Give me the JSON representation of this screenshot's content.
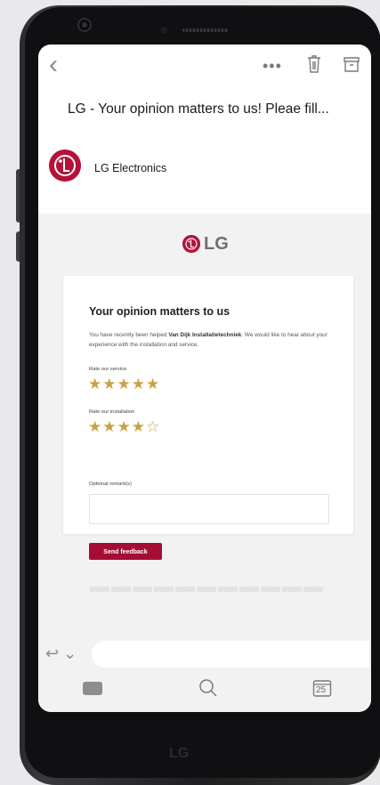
{
  "email": {
    "subject": "LG - Your opinion matters to us! Pleae fill...",
    "sender": "LG Electronics"
  },
  "brand": {
    "logo_text": "LG",
    "accent_color": "#b4123a"
  },
  "card": {
    "title": "Your opinion matters to us",
    "desc_prefix": "You have recently been helped ",
    "desc_company": "Van Dijk Installatietechniek",
    "desc_suffix": ". We would like to hear about your experience with the installation and service.",
    "service_label": "Rate our service",
    "service_rating": 5,
    "installation_label": "Rate our installation",
    "installation_rating": 4,
    "rating_max": 5,
    "remark_label": "Optional remark(s)",
    "send_label": "Send feedback"
  },
  "tabbar": {
    "calendar_day": "25"
  },
  "icons": [
    "back-icon",
    "more-icon",
    "trash-icon",
    "archive-icon",
    "reply-icon",
    "mail-icon",
    "search-icon",
    "calendar-icon"
  ],
  "phone_brand": "LG"
}
